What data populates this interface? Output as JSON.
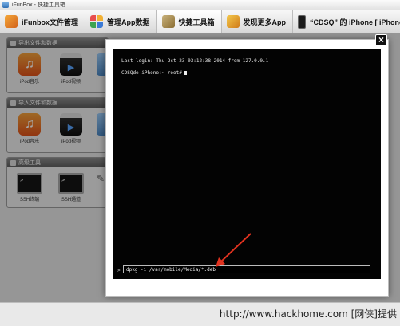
{
  "window": {
    "title": "iFunBox - 快捷工具箱"
  },
  "tabs": [
    {
      "label": "iFunbox文件管理",
      "icon": "ifunbox-icon"
    },
    {
      "label": "管理App数据",
      "icon": "apps-icon"
    },
    {
      "label": "快捷工具箱",
      "icon": "toolbox-icon",
      "active": true
    },
    {
      "label": "发现更多App",
      "icon": "discover-icon"
    },
    {
      "label": "“CDSQ” 的 iPhone [ iPhone ]",
      "icon": "iphone-icon"
    }
  ],
  "panels": {
    "export": {
      "title": "导出文件和数据",
      "items": [
        {
          "label": "iPod音乐",
          "icon": "music-icon"
        },
        {
          "label": "iPod视频",
          "icon": "video-icon"
        }
      ]
    },
    "import": {
      "title": "导入文件和数据",
      "items": [
        {
          "label": "iPod音乐",
          "icon": "music-icon"
        },
        {
          "label": "iPod视频",
          "icon": "video-icon"
        }
      ]
    },
    "advanced": {
      "title": "高级工具",
      "items": [
        {
          "label": "SSH终端",
          "icon": "terminal-icon",
          "glyph": ">_"
        },
        {
          "label": "SSH通道",
          "icon": "terminal-icon",
          "glyph": ">_"
        }
      ]
    }
  },
  "terminal": {
    "last_login": "Last login: Thu Oct 23 03:12:38 2014 from 127.0.0.1",
    "prompt": "CDSQde-iPhone:~ root#",
    "input_prompt": ">",
    "command": "dpkg -i /var/mobile/Media/*.deb",
    "close_label": "×"
  },
  "watermark": "http://www.hackhome.com [网侠]提供",
  "colors": {
    "terminal_bg": "#030303",
    "arrow": "#e0321f"
  }
}
